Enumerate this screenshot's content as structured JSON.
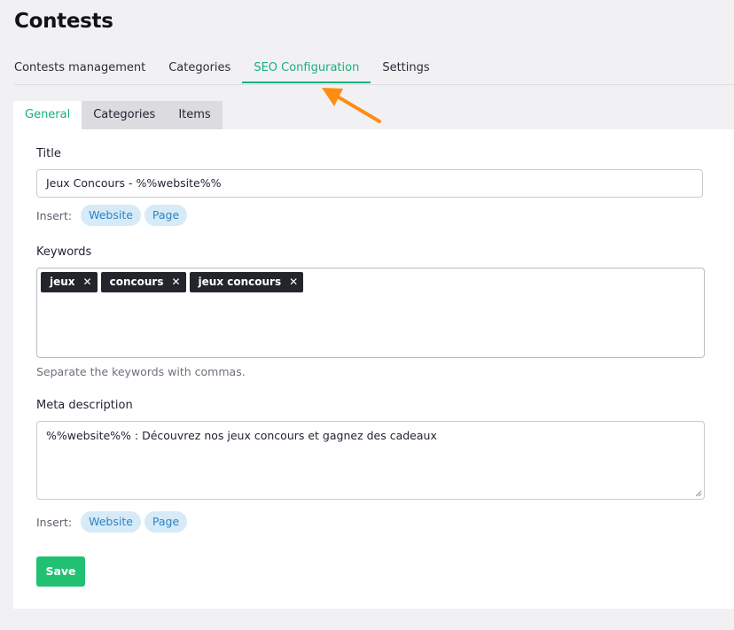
{
  "page": {
    "title": "Contests"
  },
  "top_nav": {
    "items": [
      {
        "label": "Contests management"
      },
      {
        "label": "Categories"
      },
      {
        "label": "SEO Configuration"
      },
      {
        "label": "Settings"
      }
    ],
    "active": "SEO Configuration"
  },
  "sub_tabs": {
    "items": [
      {
        "label": "General"
      },
      {
        "label": "Categories"
      },
      {
        "label": "Items"
      }
    ],
    "active": "General"
  },
  "form": {
    "title": {
      "label": "Title",
      "value": "Jeux Concours - %%website%%",
      "insert_label": "Insert:",
      "inserts": [
        "Website",
        "Page"
      ]
    },
    "keywords": {
      "label": "Keywords",
      "tags": [
        "jeux",
        "concours",
        "jeux concours"
      ],
      "remove_glyph": "✕",
      "help": "Separate the keywords with commas."
    },
    "meta_description": {
      "label": "Meta description",
      "value": "%%website%% : Découvrez nos jeux concours et gagnez des cadeaux",
      "insert_label": "Insert:",
      "inserts": [
        "Website",
        "Page"
      ]
    },
    "save_label": "Save"
  },
  "colors": {
    "accent": "#19b07a",
    "save_button": "#22c072",
    "pill_text": "#2a84c4",
    "pill_bg": "#d7eaf8",
    "tag_bg": "#22252b",
    "annotation_arrow": "#ff8c12"
  }
}
